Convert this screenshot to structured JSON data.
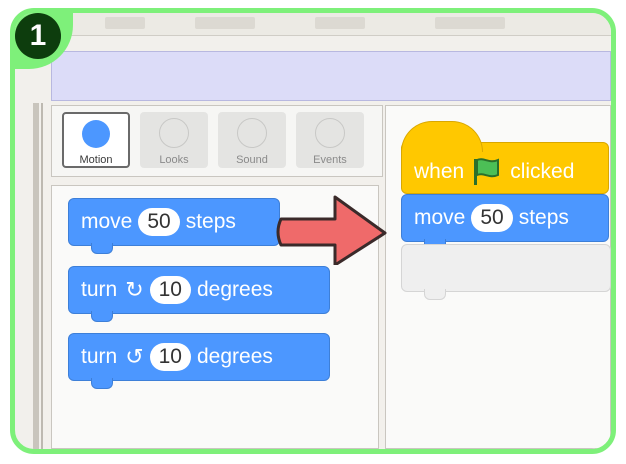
{
  "step_badge": "1",
  "categories": [
    {
      "label": "Motion",
      "state": "active"
    },
    {
      "label": "Looks",
      "state": "disabled"
    },
    {
      "label": "Sound",
      "state": "disabled"
    },
    {
      "label": "Events",
      "state": "disabled"
    }
  ],
  "palette_blocks": {
    "move": {
      "before": "move",
      "value": "50",
      "after": "steps"
    },
    "turn_right": {
      "before": "turn",
      "icon": "↻",
      "value": "10",
      "after": "degrees"
    },
    "turn_left": {
      "before": "turn",
      "icon": "↺",
      "value": "10",
      "after": "degrees"
    }
  },
  "script": {
    "hat": {
      "before": "when",
      "icon": "green-flag-icon",
      "after": "clicked"
    },
    "move": {
      "before": "move",
      "value": "50",
      "after": "steps"
    }
  },
  "colors": {
    "motion": "#4c97ff",
    "events": "#ffc800",
    "frame": "#7ef07a",
    "arrow": "#ef6a6a"
  }
}
